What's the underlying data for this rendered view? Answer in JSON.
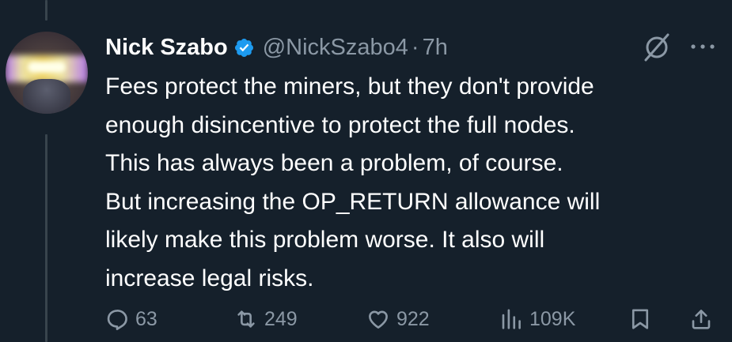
{
  "tweet": {
    "author_name": "Nick Szabo",
    "handle": "@NickSzabo4",
    "separator": "·",
    "time": "7h",
    "text": "Fees protect the miners, but they don't provide\nenough disincentive to protect the full nodes.\nThis has always been a problem, of course.\nBut increasing the OP_RETURN allowance will\nlikely make this problem worse.  It also will\nincrease legal risks."
  },
  "actions": {
    "replies": "63",
    "retweets": "249",
    "likes": "922",
    "views": "109K"
  },
  "icons": {
    "verified": "verified-badge-icon",
    "grok": "grok-icon",
    "more": "more-icon",
    "reply": "reply-icon",
    "retweet": "retweet-icon",
    "like": "heart-icon",
    "views": "views-icon",
    "bookmark": "bookmark-icon",
    "share": "share-icon"
  },
  "colors": {
    "background": "#15202b",
    "text": "#ffffff",
    "secondary": "#8b98a5",
    "verified": "#1d9bf0",
    "thread_line": "#38444d"
  }
}
